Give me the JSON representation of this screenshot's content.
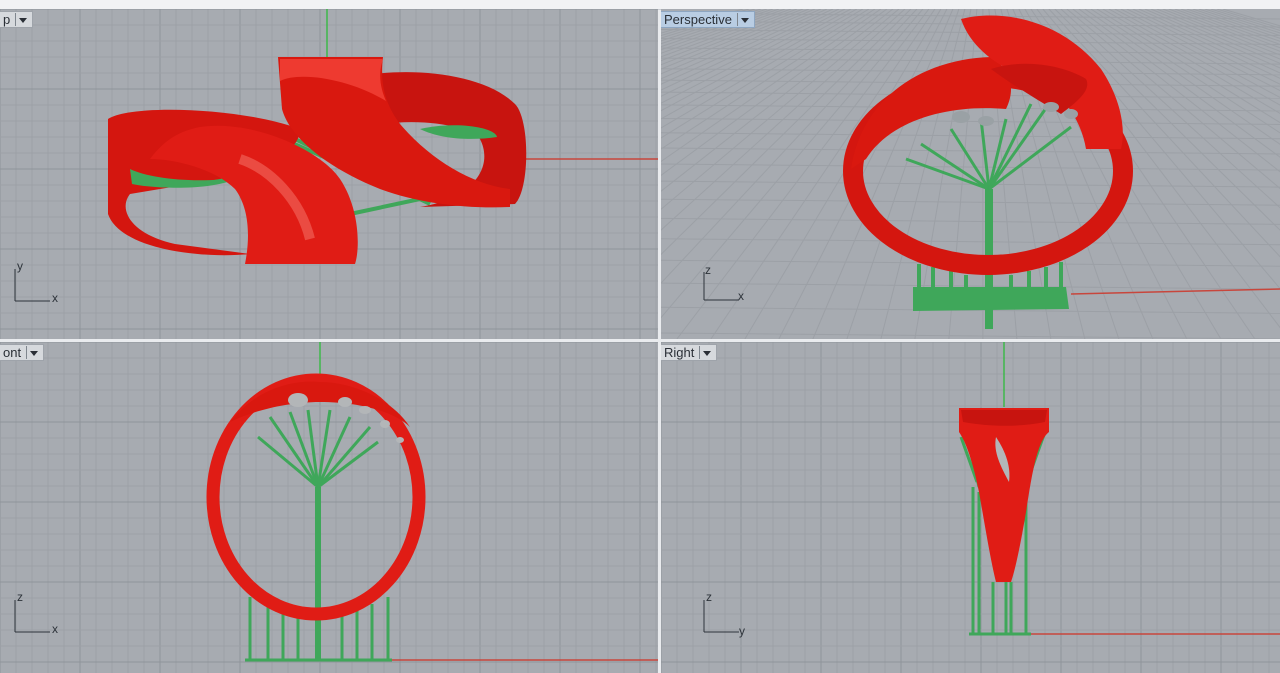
{
  "viewports": [
    {
      "id": "top",
      "title": "p",
      "axes": {
        "vertical": "y",
        "horizontal": "x"
      },
      "active": false
    },
    {
      "id": "perspective",
      "title": "Perspective",
      "axes": {
        "vertical": "z",
        "horizontal": "x"
      },
      "active": true
    },
    {
      "id": "front",
      "title": "ont",
      "axes": {
        "vertical": "z",
        "horizontal": "x"
      },
      "active": false
    },
    {
      "id": "right",
      "title": "Right",
      "axes": {
        "vertical": "z",
        "horizontal": "y"
      },
      "active": false
    }
  ],
  "colors": {
    "background": "#a7abb1",
    "grid_minor": "#9ca0a6",
    "grid_major": "#8f949a",
    "model": "#e11b14",
    "supports": "#3fa75a",
    "x_axis": "#c8463c",
    "y_axis": "#3db84a"
  },
  "icons": [
    "dropdown-arrow-icon"
  ]
}
